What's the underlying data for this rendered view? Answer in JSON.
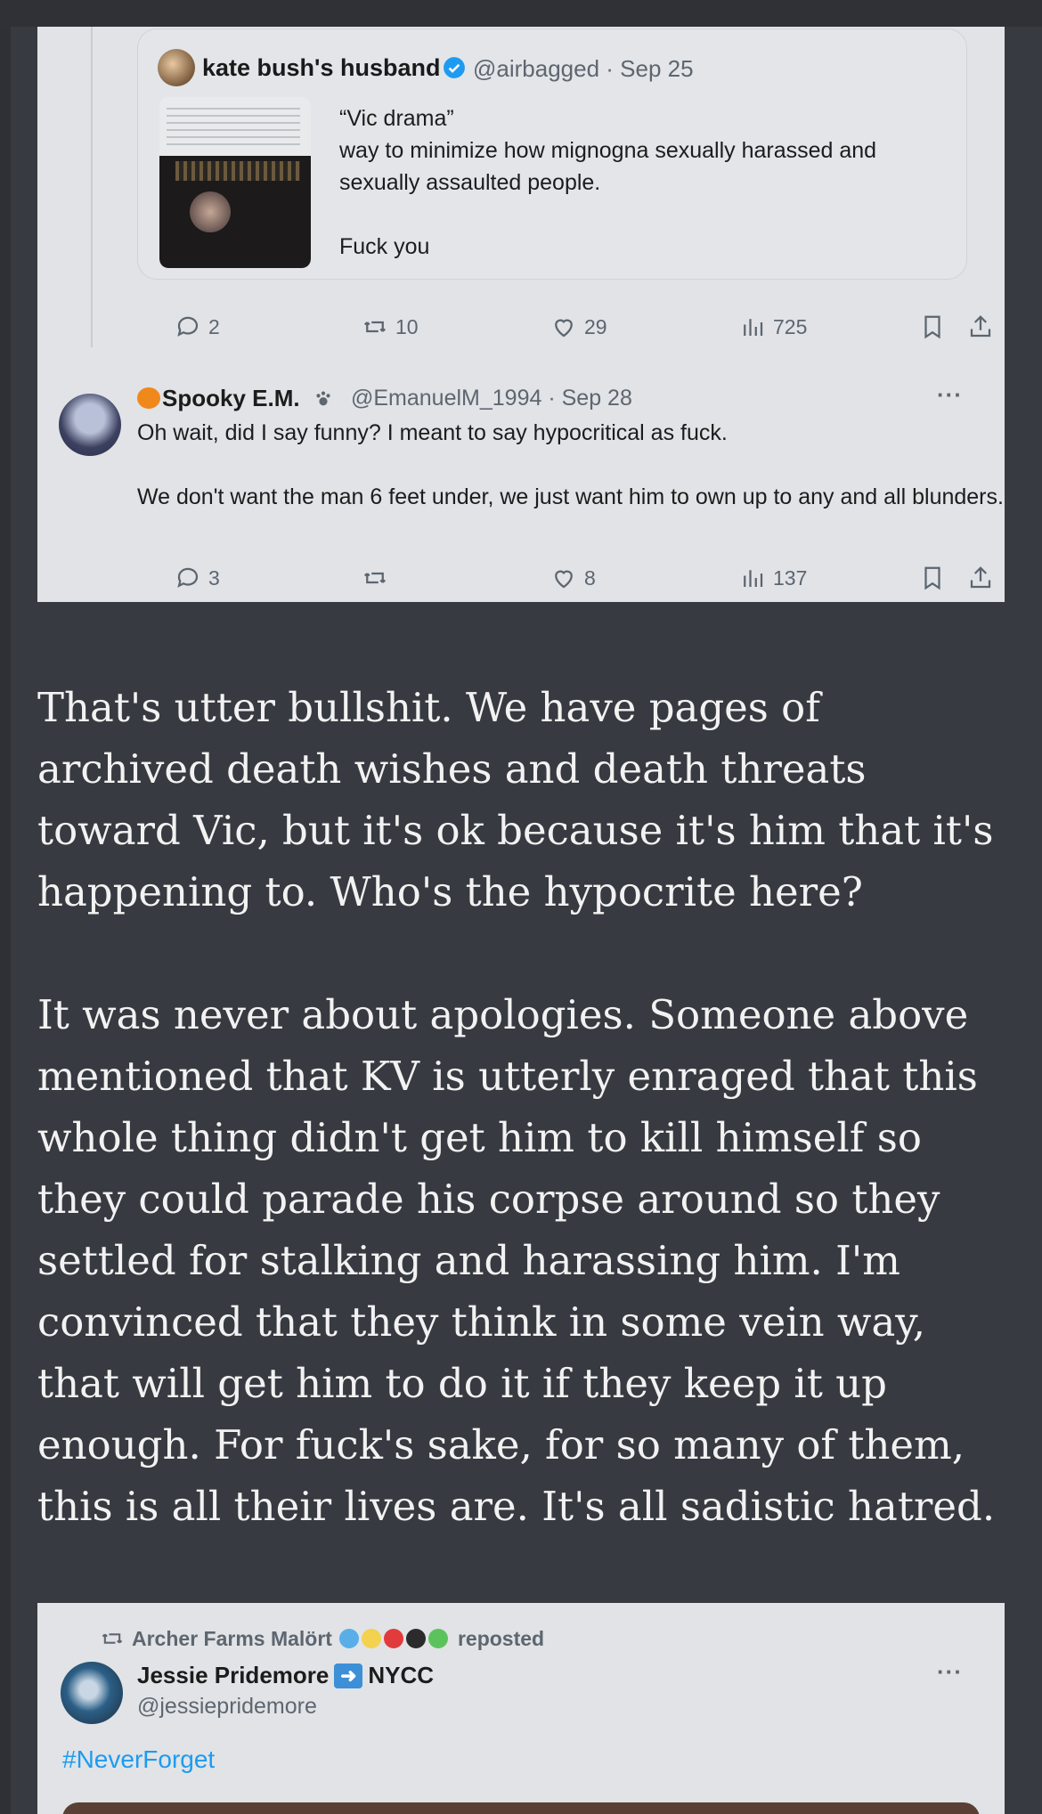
{
  "quoted_tweet": {
    "author_name": "kate bush's husband",
    "handle_date": "@airbagged · Sep 25",
    "text_lines": [
      "“Vic drama”",
      "way to minimize how mignogna sexually harassed and sexually assaulted people.",
      "",
      "Fuck you"
    ],
    "stats": {
      "replies": "2",
      "reposts": "10",
      "likes": "29",
      "views": "725"
    }
  },
  "reply_tweet": {
    "author_name": "Spooky E.M.",
    "handle_date": "@EmanuelM_1994 · Sep 28",
    "more": "···",
    "text_lines": [
      "Oh wait, did I say funny? I meant to say hypocritical as fuck.",
      "",
      "We don't want the man 6 feet under, we just want him to own up to any and all blunders."
    ],
    "stats": {
      "replies": "3",
      "reposts": "",
      "likes": "8",
      "views": "137"
    }
  },
  "post": {
    "paragraphs": [
      "That's utter bullshit. We have pages of archived death wishes and death threats toward Vic, but it's ok because it's him that it's happening to. Who's the hypocrite here?",
      "It was never about apologies. Someone above mentioned that KV is utterly enraged that this whole thing didn't get him to kill himself so they could parade his corpse around so they settled for stalking and harassing him. I'm convinced that they think in some vein way, that will get him to do it if they keep it up enough. For fuck's sake, for so many of them, this is all their lives are. It's all sadistic hatred."
    ]
  },
  "repost_tweet": {
    "reposter": "Archer Farms Malört",
    "reposted_label": "reposted",
    "heart_colors": [
      "#5aaee8",
      "#f2d24e",
      "#e23b3b",
      "#2b2b2b",
      "#5cc35c"
    ],
    "author_name": "Jessie Pridemore",
    "author_suffix": "NYCC",
    "handle": "@jessiepridemore",
    "more": "···",
    "hashtag": "#NeverForget"
  }
}
